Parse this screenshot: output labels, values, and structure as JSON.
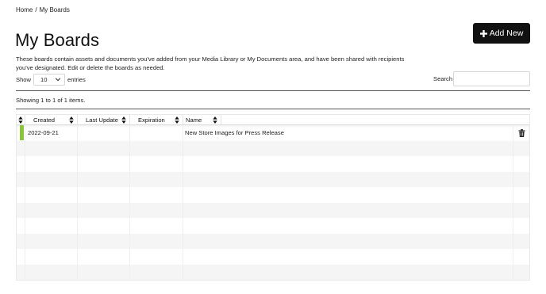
{
  "breadcrumb": {
    "home": "Home",
    "separator": "/",
    "current": "My Boards"
  },
  "page": {
    "title": "My Boards",
    "description": "These boards contain assets and documents you've added from your Media Library or My Documents area, and have been shared with recipients you've designated. Edit or delete the boards as needed."
  },
  "add_button": {
    "icon": "plus-icon",
    "label": "Add New"
  },
  "length_menu": {
    "prefix": "Show",
    "selected": "10",
    "suffix": "entries"
  },
  "search": {
    "label": "Search",
    "value": "",
    "placeholder": ""
  },
  "info": "Showing 1 to 1 of 1 items.",
  "table": {
    "columns": [
      "Created",
      "Last Update",
      "Expiration",
      "Name"
    ],
    "rows": [
      {
        "created": "2022-09-21",
        "last_update": "",
        "expiration": "",
        "name": "New Store Images for Press Release",
        "status_color": "#8ac43b",
        "action_icon": "trash-icon"
      }
    ]
  },
  "colors": {
    "button_bg": "#111111",
    "status_active": "#8ac43b",
    "stripe": "#f5f5f5"
  }
}
